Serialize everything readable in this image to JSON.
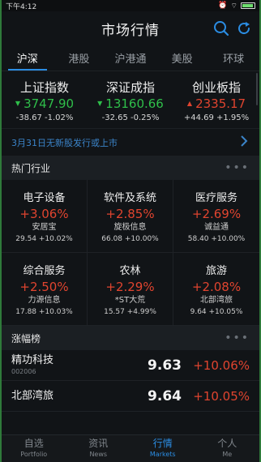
{
  "status": {
    "time": "下午4:12"
  },
  "header": {
    "title": "市场行情",
    "search_icon": "search-icon",
    "refresh_icon": "refresh-icon"
  },
  "tabs": [
    {
      "label": "沪深",
      "active": true
    },
    {
      "label": "港股",
      "active": false
    },
    {
      "label": "沪港通",
      "active": false
    },
    {
      "label": "美股",
      "active": false
    },
    {
      "label": "环球",
      "active": false
    }
  ],
  "indices": [
    {
      "name": "上证指数",
      "value": "3747.90",
      "change": "-38.67 -1.02%",
      "direction": "down"
    },
    {
      "name": "深证成指",
      "value": "13160.66",
      "change": "-32.65 -0.25%",
      "direction": "down"
    },
    {
      "name": "创业板指",
      "value": "2335.17",
      "change": "+44.69 +1.95%",
      "direction": "up"
    }
  ],
  "notice": {
    "text": "3月31日无新股发行或上市"
  },
  "hot_industry": {
    "title": "热门行业",
    "items": [
      {
        "name": "电子设备",
        "pct": "+3.06%",
        "stock": "安居宝",
        "detail": "29.54 +10.02%"
      },
      {
        "name": "软件及系统",
        "pct": "+2.85%",
        "stock": "旋极信息",
        "detail": "66.08 +10.00%"
      },
      {
        "name": "医疗服务",
        "pct": "+2.69%",
        "stock": "诚益通",
        "detail": "58.40 +10.00%"
      },
      {
        "name": "综合服务",
        "pct": "+2.50%",
        "stock": "力源信息",
        "detail": "17.88 +10.03%"
      },
      {
        "name": "农林",
        "pct": "+2.29%",
        "stock": "*ST大荒",
        "detail": "15.57 +4.99%"
      },
      {
        "name": "旅游",
        "pct": "+2.08%",
        "stock": "北部湾旅",
        "detail": "9.64 +10.05%"
      }
    ]
  },
  "gainers": {
    "title": "涨幅榜",
    "rows": [
      {
        "name": "精功科技",
        "code": "002006",
        "price": "9.63",
        "pct": "+10.06%"
      },
      {
        "name": "北部湾旅",
        "code": "",
        "price": "9.64",
        "pct": "+10.05%"
      }
    ]
  },
  "tabbar": [
    {
      "cn": "自选",
      "en": "Portfolio",
      "active": false
    },
    {
      "cn": "资讯",
      "en": "News",
      "active": false
    },
    {
      "cn": "行情",
      "en": "Markets",
      "active": true
    },
    {
      "cn": "个人",
      "en": "Me",
      "active": false
    }
  ],
  "colors": {
    "up": "#e0442f",
    "down": "#2fbf4a",
    "accent": "#2b8de3"
  }
}
